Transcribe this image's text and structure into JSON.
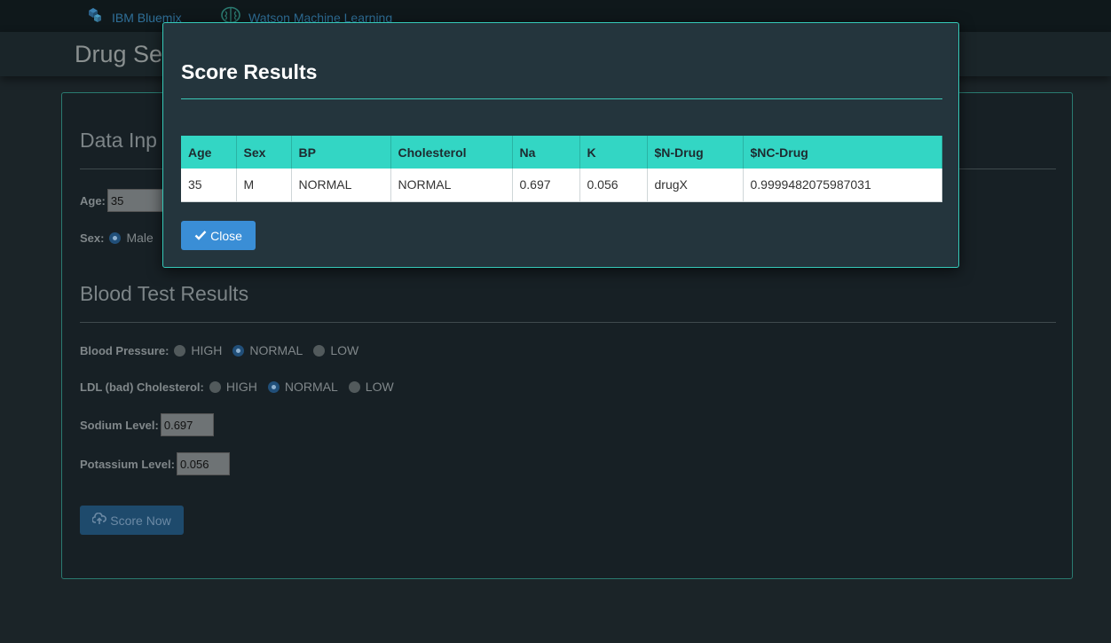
{
  "nav": {
    "ibm_label": "IBM Bluemix",
    "watson_label": "Watson Machine Learning"
  },
  "page": {
    "title": "Drug Se"
  },
  "data_input": {
    "heading": "Data Inp",
    "age_label": "Age:",
    "age_value": "35",
    "sex_label": "Sex:",
    "sex_option": "Male"
  },
  "blood": {
    "heading": "Blood Test Results",
    "bp_label": "Blood Pressure:",
    "bp_options": [
      "HIGH",
      "NORMAL",
      "LOW"
    ],
    "bp_selected": "NORMAL",
    "chol_label": "LDL (bad) Cholesterol:",
    "chol_options": [
      "HIGH",
      "NORMAL",
      "LOW"
    ],
    "chol_selected": "NORMAL",
    "sodium_label": "Sodium Level:",
    "sodium_value": "0.697",
    "potassium_label": "Potassium Level:",
    "potassium_value": "0.056"
  },
  "score_button": "Score Now",
  "modal": {
    "title": "Score Results",
    "columns": [
      "Age",
      "Sex",
      "BP",
      "Cholesterol",
      "Na",
      "K",
      "$N-Drug",
      "$NC-Drug"
    ],
    "rows": [
      [
        "35",
        "M",
        "NORMAL",
        "NORMAL",
        "0.697",
        "0.056",
        "drugX",
        "0.9999482075987031"
      ]
    ],
    "close_label": "Close"
  },
  "colors": {
    "accent": "#33d6c4",
    "button_primary": "#3a8ed6",
    "background": "#1b2428"
  },
  "icons": {
    "ibm": "bluemix-cubes-icon",
    "watson": "brain-icon",
    "close": "check-icon",
    "score": "cloud-upload-icon"
  }
}
